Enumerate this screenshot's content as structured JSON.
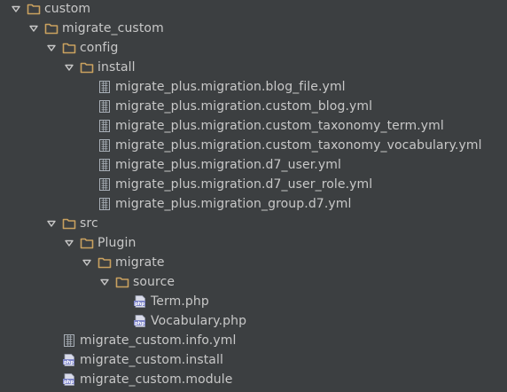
{
  "tree": [
    {
      "label": "custom",
      "type": "folder",
      "depth": 0,
      "expanded": true,
      "icon": "folder-icon"
    },
    {
      "label": "migrate_custom",
      "type": "folder",
      "depth": 1,
      "expanded": true,
      "icon": "folder-icon"
    },
    {
      "label": "config",
      "type": "folder",
      "depth": 2,
      "expanded": true,
      "icon": "folder-icon"
    },
    {
      "label": "install",
      "type": "folder",
      "depth": 3,
      "expanded": true,
      "icon": "folder-icon"
    },
    {
      "label": "migrate_plus.migration.blog_file.yml",
      "type": "file",
      "depth": 4,
      "icon": "yml-file-icon"
    },
    {
      "label": "migrate_plus.migration.custom_blog.yml",
      "type": "file",
      "depth": 4,
      "icon": "yml-file-icon"
    },
    {
      "label": "migrate_plus.migration.custom_taxonomy_term.yml",
      "type": "file",
      "depth": 4,
      "icon": "yml-file-icon"
    },
    {
      "label": "migrate_plus.migration.custom_taxonomy_vocabulary.yml",
      "type": "file",
      "depth": 4,
      "icon": "yml-file-icon"
    },
    {
      "label": "migrate_plus.migration.d7_user.yml",
      "type": "file",
      "depth": 4,
      "icon": "yml-file-icon"
    },
    {
      "label": "migrate_plus.migration.d7_user_role.yml",
      "type": "file",
      "depth": 4,
      "icon": "yml-file-icon"
    },
    {
      "label": "migrate_plus.migration_group.d7.yml",
      "type": "file",
      "depth": 4,
      "icon": "yml-file-icon"
    },
    {
      "label": "src",
      "type": "folder",
      "depth": 2,
      "expanded": true,
      "icon": "folder-icon"
    },
    {
      "label": "Plugin",
      "type": "folder",
      "depth": 3,
      "expanded": true,
      "icon": "folder-icon"
    },
    {
      "label": "migrate",
      "type": "folder",
      "depth": 4,
      "expanded": true,
      "icon": "folder-icon"
    },
    {
      "label": "source",
      "type": "folder",
      "depth": 5,
      "expanded": true,
      "icon": "folder-icon"
    },
    {
      "label": "Term.php",
      "type": "file",
      "depth": 6,
      "icon": "php-file-icon"
    },
    {
      "label": "Vocabulary.php",
      "type": "file",
      "depth": 6,
      "icon": "php-file-icon"
    },
    {
      "label": "migrate_custom.info.yml",
      "type": "file",
      "depth": 2,
      "icon": "yml-file-icon"
    },
    {
      "label": "migrate_custom.install",
      "type": "file",
      "depth": 2,
      "icon": "php-file-icon"
    },
    {
      "label": "migrate_custom.module",
      "type": "file",
      "depth": 2,
      "icon": "php-file-icon"
    }
  ],
  "colors": {
    "background": "#3c3f41",
    "text": "#c8c8c8",
    "folder": "#c9a15f",
    "arrow": "#c8c8c8",
    "yml_icon": "#a9b0b8",
    "php_icon": "#7f86c9"
  }
}
